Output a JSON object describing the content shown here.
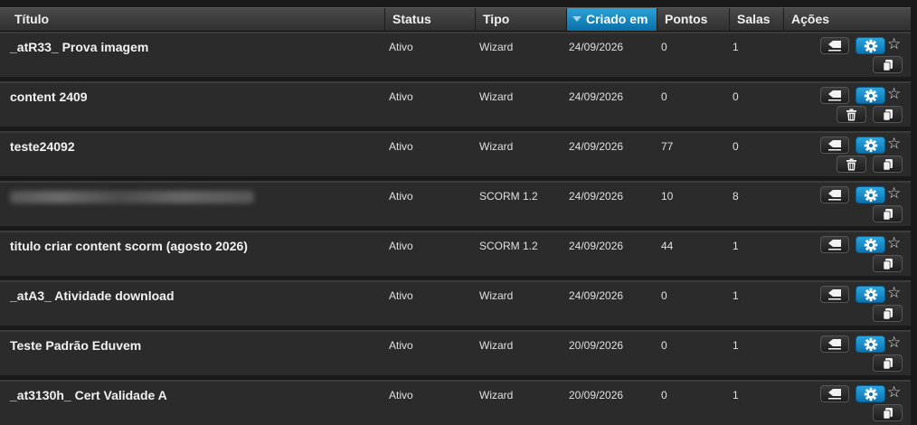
{
  "columns": {
    "title": "Título",
    "status": "Status",
    "tipo": "Tipo",
    "criado": "Criado em",
    "pontos": "Pontos",
    "salas": "Salas",
    "acoes": "Ações"
  },
  "sorted_column": "criado",
  "rows": [
    {
      "title": "_atR33_ Prova imagem",
      "status": "Ativo",
      "tipo": "Wizard",
      "criado": "24/09/2026",
      "pontos": "0",
      "salas": "1",
      "has_trash": false,
      "blurred": false
    },
    {
      "title": "content 2409",
      "status": "Ativo",
      "tipo": "Wizard",
      "criado": "24/09/2026",
      "pontos": "0",
      "salas": "0",
      "has_trash": true,
      "blurred": false
    },
    {
      "title": "teste24092",
      "status": "Ativo",
      "tipo": "Wizard",
      "criado": "24/09/2026",
      "pontos": "77",
      "salas": "0",
      "has_trash": true,
      "blurred": false
    },
    {
      "title": "",
      "status": "Ativo",
      "tipo": "SCORM 1.2",
      "criado": "24/09/2026",
      "pontos": "10",
      "salas": "8",
      "has_trash": false,
      "blurred": true
    },
    {
      "title": "titulo criar content scorm (agosto 2026)",
      "status": "Ativo",
      "tipo": "SCORM 1.2",
      "criado": "24/09/2026",
      "pontos": "44",
      "salas": "1",
      "has_trash": false,
      "blurred": false
    },
    {
      "title": "_atA3_ Atividade download",
      "status": "Ativo",
      "tipo": "Wizard",
      "criado": "24/09/2026",
      "pontos": "0",
      "salas": "1",
      "has_trash": false,
      "blurred": false
    },
    {
      "title": "Teste Padrão Eduvem",
      "status": "Ativo",
      "tipo": "Wizard",
      "criado": "20/09/2026",
      "pontos": "0",
      "salas": "1",
      "has_trash": false,
      "blurred": false
    },
    {
      "title": "_at3130h_ Cert Validade A",
      "status": "Ativo",
      "tipo": "Wizard",
      "criado": "20/09/2026",
      "pontos": "0",
      "salas": "1",
      "has_trash": false,
      "blurred": false
    }
  ],
  "icons": {
    "erase": "eraser-icon",
    "settings": "gear-icon",
    "favorite": "star-icon",
    "duplicate": "copy-icon",
    "delete": "trash-icon"
  },
  "colors": {
    "accent": "#1a8fcf",
    "row_bg": "#2b2b2b",
    "page_bg": "#1a1a1a"
  }
}
